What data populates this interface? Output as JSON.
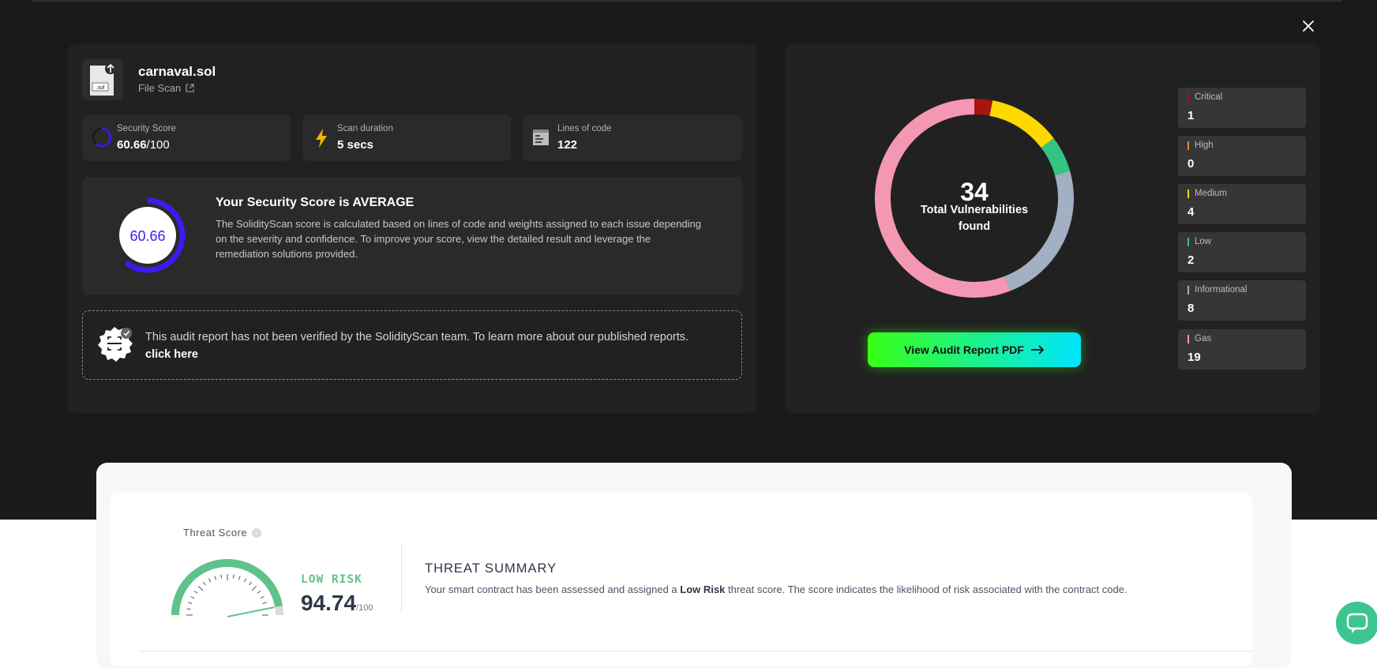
{
  "file": {
    "name": "carnaval.sol",
    "type_link": "File Scan",
    "icon_label": ".sol"
  },
  "stats": {
    "security_score": {
      "label": "Security Score",
      "value": "60.66",
      "denominator": "/100",
      "fraction": 0.6066
    },
    "scan_duration": {
      "label": "Scan duration",
      "value": "5 secs"
    },
    "lines_of_code": {
      "label": "Lines of code",
      "value": "122"
    }
  },
  "score_card": {
    "gauge_value": "60.66",
    "gauge_fraction": 0.6066,
    "title": "Your Security Score is AVERAGE",
    "description": "The SolidityScan score is calculated based on lines of code and weights assigned to each issue depending on the severity and confidence. To improve your score, view the detailed result and leverage the remediation solutions provided."
  },
  "audit_notice": {
    "text": "This audit report has not been verified by the SolidityScan team. To learn more about our published reports.",
    "link": "click here"
  },
  "vulnerabilities": {
    "total": "34",
    "total_label_line1": "Total Vulnerabilities",
    "total_label_line2": "found",
    "categories": [
      {
        "label": "Critical",
        "count": "1",
        "color": "#a8140e"
      },
      {
        "label": "High",
        "count": "0",
        "color": "#f08a24"
      },
      {
        "label": "Medium",
        "count": "4",
        "color": "#ffd800"
      },
      {
        "label": "Low",
        "count": "2",
        "color": "#33c481"
      },
      {
        "label": "Informational",
        "count": "8",
        "color": "#a3afc2"
      },
      {
        "label": "Gas",
        "count": "19",
        "color": "#f497b2"
      }
    ]
  },
  "pdf_button": {
    "label": "View Audit Report PDF"
  },
  "threat": {
    "label": "Threat Score",
    "risk_label": "LOW RISK",
    "value": "94.74",
    "denominator": "/100",
    "fraction": 0.9474,
    "summary_title": "THREAT SUMMARY",
    "summary_prefix": "Your smart contract has been assessed and assigned a",
    "summary_bold": "Low Risk",
    "summary_suffix": "threat score. The score indicates the likelihood of risk associated with the contract code."
  },
  "colors": {
    "accent_purple": "#3a1cf0",
    "risk_green": "#5ec38b",
    "chat_green": "#3ec58f"
  }
}
